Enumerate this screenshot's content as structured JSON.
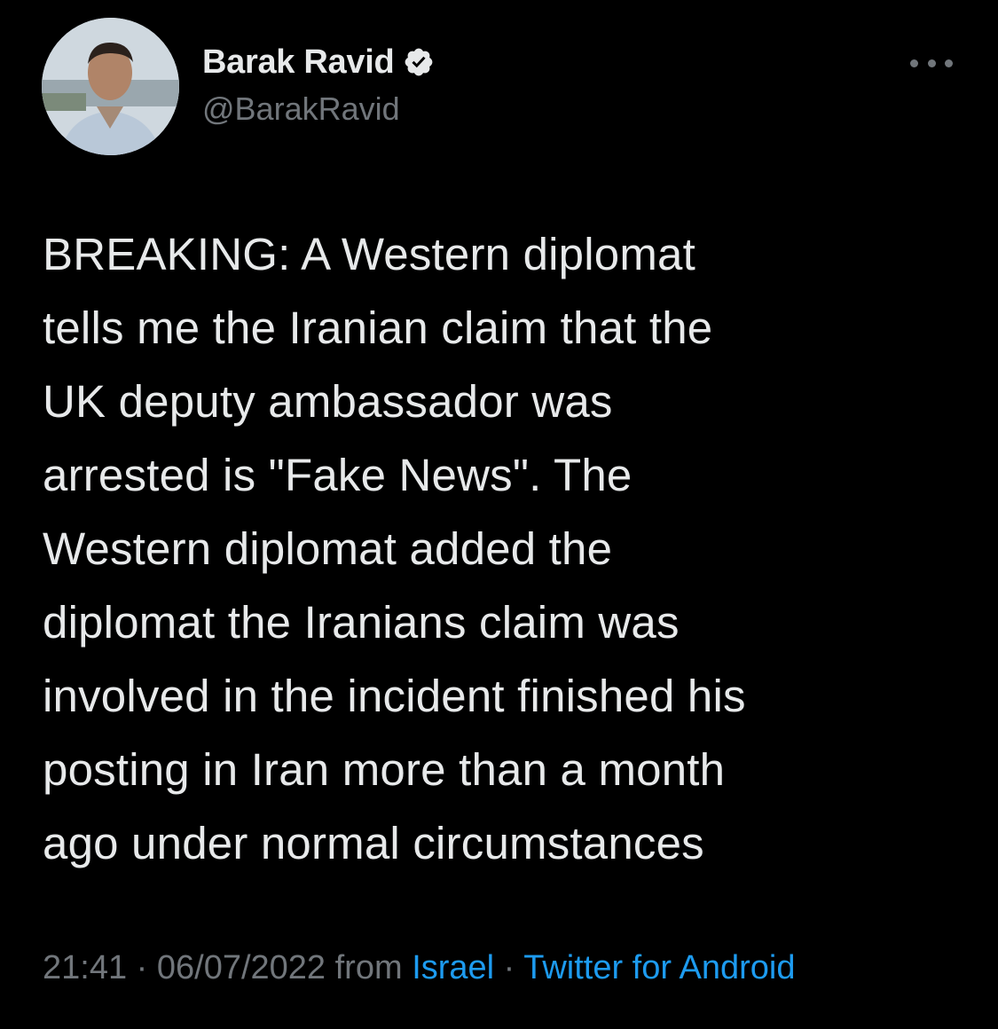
{
  "author": {
    "display_name": "Barak Ravid",
    "handle": "@BarakRavid",
    "verified": true,
    "verified_color": "#e7e9ea"
  },
  "menu": {
    "more_icon": "more-horizontal-icon"
  },
  "tweet": {
    "text": "BREAKING: A Western diplomat\ntells me the Iranian claim that the\nUK deputy ambassador was\narrested is \"Fake News\". The\nWestern diplomat added the\ndiplomat the Iranians claim was\ninvolved in the incident finished his\nposting in Iran more than a month\nago under normal circumstances"
  },
  "meta": {
    "time": "21:41",
    "separator": " · ",
    "date": "06/07/2022",
    "from_label": " from ",
    "location": "Israel",
    "source": "Twitter for Android"
  },
  "colors": {
    "background": "#000000",
    "text_primary": "#e7e9ea",
    "text_secondary": "#71767b",
    "link": "#1d9bf0"
  }
}
